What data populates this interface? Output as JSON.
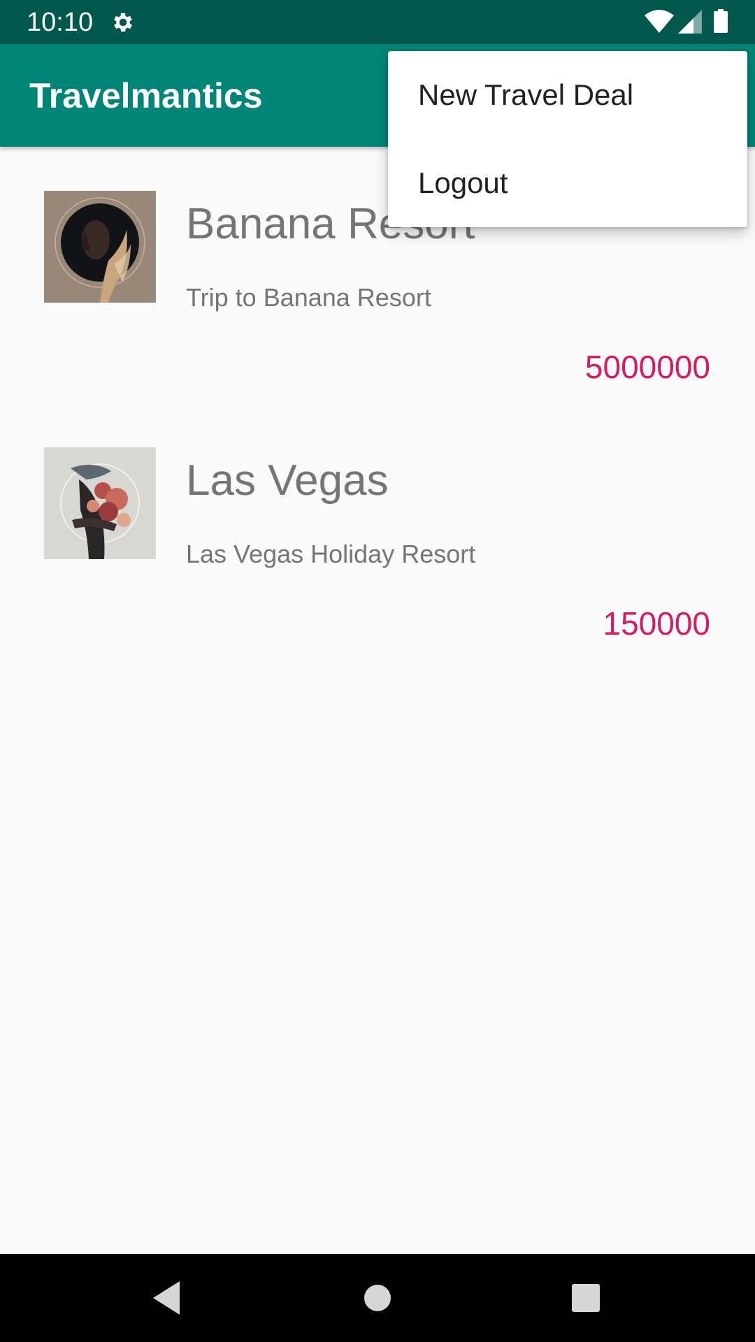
{
  "status_bar": {
    "time": "10:10",
    "icons": [
      "gear-icon",
      "wifi-icon",
      "signal-icon",
      "battery-icon"
    ],
    "color": "#00574b"
  },
  "app_bar": {
    "title": "Travelmantics",
    "color": "#008577"
  },
  "deals": [
    {
      "title": "Banana Resort",
      "description": "Trip to Banana Resort",
      "price": "5000000",
      "thumbnail": "portrait-artwork-thumbnail"
    },
    {
      "title": "Las Vegas",
      "description": "Las Vegas Holiday Resort",
      "price": "150000",
      "thumbnail": "hands-flowers-artwork-thumbnail"
    }
  ],
  "overflow_menu": {
    "items": [
      {
        "label": "New Travel Deal"
      },
      {
        "label": "Logout"
      }
    ]
  },
  "nav_bar": {
    "buttons": [
      "back-icon",
      "home-icon",
      "recents-icon"
    ]
  },
  "colors": {
    "accent": "#d81b60",
    "primary": "#008577",
    "primary_dark": "#00574b"
  }
}
